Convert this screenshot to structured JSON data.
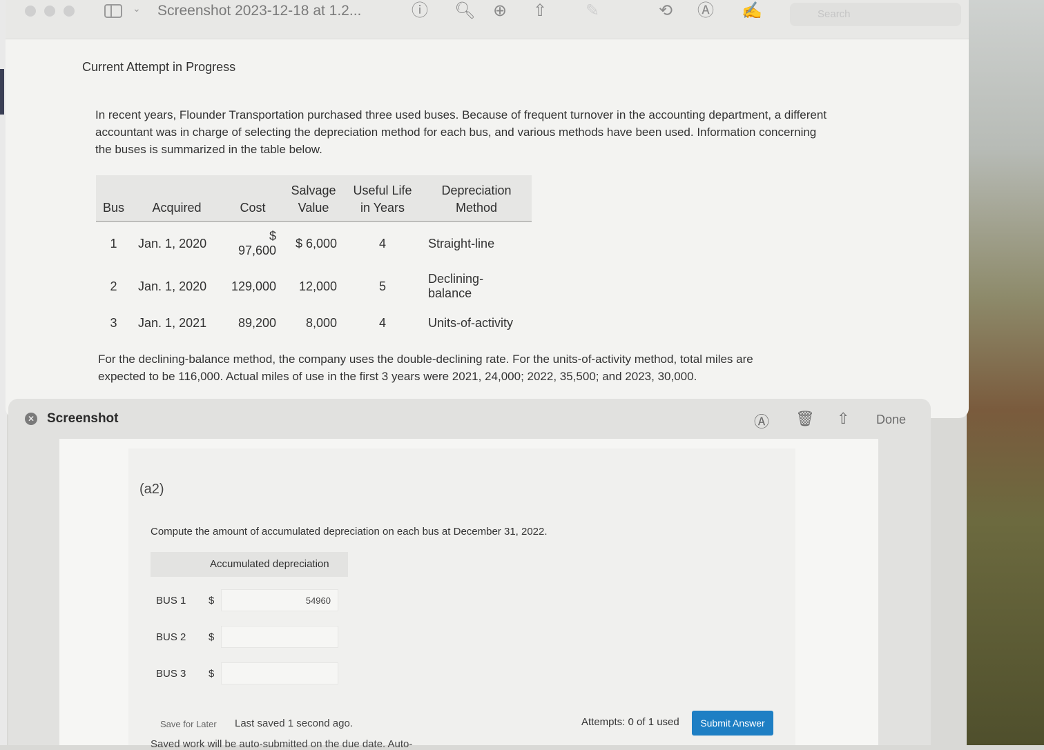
{
  "window": {
    "title": "Screenshot 2023-12-18 at 1.2...",
    "search_placeholder": "Search"
  },
  "content": {
    "attempt_title": "Current Attempt in Progress",
    "intro": "In recent years, Flounder Transportation purchased three used buses. Because of frequent turnover in the accounting department, a different accountant was in charge of selecting the depreciation method for each bus, and various methods have been used. Information concerning the buses is summarized in the table below.",
    "table": {
      "headers": [
        "Bus",
        "Acquired",
        "Cost",
        "Salvage Value",
        "Useful Life in Years",
        "Depreciation Method"
      ],
      "rows": [
        [
          "1",
          "Jan. 1, 2020",
          "$ 97,600",
          "$ 6,000",
          "4",
          "Straight-line"
        ],
        [
          "2",
          "Jan. 1, 2020",
          "129,000",
          "12,000",
          "5",
          "Declining-balance"
        ],
        [
          "3",
          "Jan. 1, 2021",
          "89,200",
          "8,000",
          "4",
          "Units-of-activity"
        ]
      ]
    },
    "note": "For the declining-balance method, the company uses the double-declining rate. For the units-of-activity method, total miles are expected to be 116,000. Actual miles of use in the first 3 years were 2021, 24,000; 2022, 35,500; and 2023, 30,000."
  },
  "panel": {
    "title": "Screenshot",
    "done_label": "Done",
    "part_label": "(a2)",
    "prompt": "Compute the amount of accumulated depreciation on each bus at December 31, 2022.",
    "column_header": "Accumulated depreciation",
    "currency": "$",
    "rows": [
      {
        "label": "BUS 1",
        "value": "54960"
      },
      {
        "label": "BUS 2",
        "value": ""
      },
      {
        "label": "BUS 3",
        "value": ""
      }
    ],
    "save_later": "Save for Later",
    "last_saved": "Last saved 1 second ago.",
    "auto_note": "Saved work will be auto-submitted on the due date. Auto-",
    "attempts": "Attempts: 0 of 1 used",
    "submit_label": "Submit Answer"
  },
  "colors": {
    "submit_button": "#1e7fc4"
  }
}
